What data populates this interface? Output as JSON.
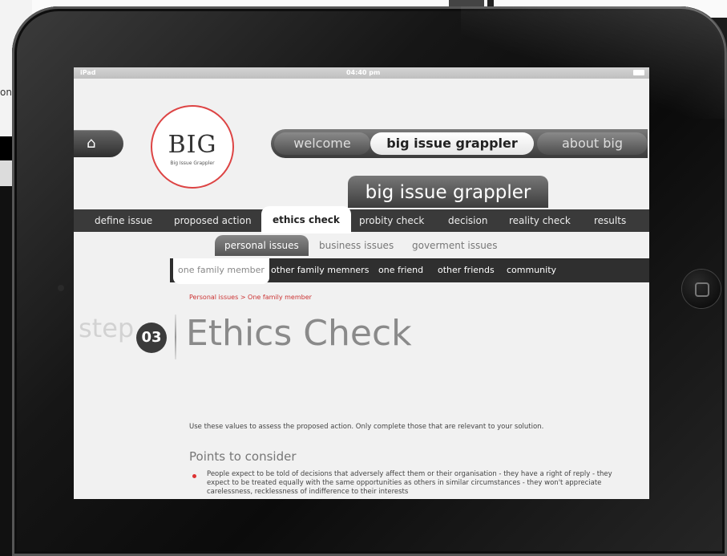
{
  "background": {
    "edge_text": "on"
  },
  "statusbar": {
    "device": "iPad",
    "time": "04:40 pm"
  },
  "logo": {
    "text": "BIG",
    "subtitle": "Big Issue Grappler"
  },
  "topnav": {
    "welcome": "welcome",
    "big_issue_grappler": "big issue grappler",
    "about_big": "about big"
  },
  "section_title": "big issue grappler",
  "mainnav": {
    "items": [
      {
        "label": "define issue"
      },
      {
        "label": "proposed action"
      },
      {
        "label": "ethics check"
      },
      {
        "label": "probity check"
      },
      {
        "label": "decision"
      },
      {
        "label": "reality check"
      },
      {
        "label": "results"
      }
    ],
    "active": "ethics check"
  },
  "subnav": {
    "items": [
      {
        "label": "personal issues"
      },
      {
        "label": "business issues"
      },
      {
        "label": "goverment issues"
      }
    ],
    "active": "personal issues"
  },
  "subnav2": {
    "items": [
      {
        "label": "one family member"
      },
      {
        "label": "other family memners"
      },
      {
        "label": "one friend"
      },
      {
        "label": "other friends"
      },
      {
        "label": "community"
      }
    ],
    "active": "one family member"
  },
  "breadcrumb": "Personal issues > One family member",
  "step": {
    "label": "step",
    "number": "03"
  },
  "page_title": "Ethics Check",
  "intro": "Use these values to assess the proposed action. Only complete those that are relevant to your solution.",
  "points_heading": "Points to consider",
  "points": [
    "People expect to be told of decisions that adversely affect them or their organisation - they have a right of reply - they expect to be treated equally with the same opportunities as others in similar circumstances - they won't appreciate carelessness, recklessness of indifference to their interests"
  ],
  "colors": {
    "accent_red": "#d33333",
    "nav_dark": "#3a3a3a"
  }
}
